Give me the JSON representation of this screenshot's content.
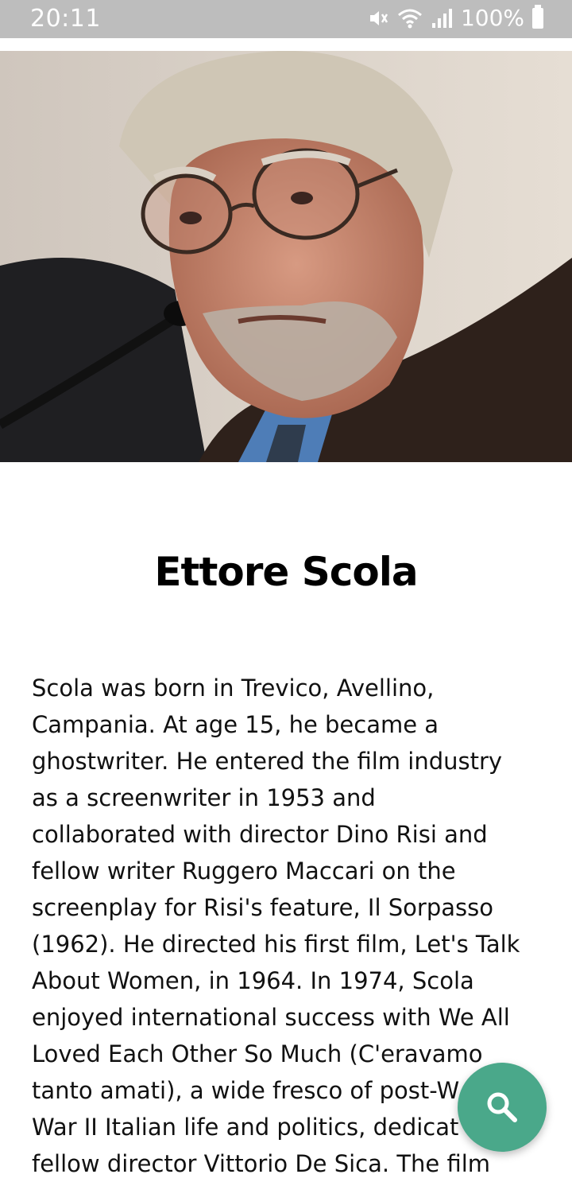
{
  "status_bar": {
    "time": "20:11",
    "battery": "100%",
    "icons": [
      "mute-icon",
      "wifi-icon",
      "signal-icon",
      "battery-icon"
    ]
  },
  "hero_image": {
    "icon": "portrait-photo"
  },
  "article": {
    "title": "Ettore Scola",
    "body": "Scola was born in Trevico, Avellino,\nCampania. At age 15, he became a\nghostwriter.  He entered the film industry\nas a screenwriter in 1953 and\ncollaborated with director Dino Risi and\nfellow writer Ruggero Maccari on the\nscreenplay for Risi's feature, Il Sorpasso\n(1962). He directed his first film, Let's Talk\nAbout Women, in 1964. In 1974, Scola\nenjoyed international success with We All\nLoved Each Other So Much (C'eravamo\ntanto amati), a wide fresco of post-W\nWar II Italian life and politics, dedicat\nfellow director Vittorio De Sica. The film"
  },
  "fab": {
    "icon": "search-icon",
    "color": "#4aa88a"
  }
}
